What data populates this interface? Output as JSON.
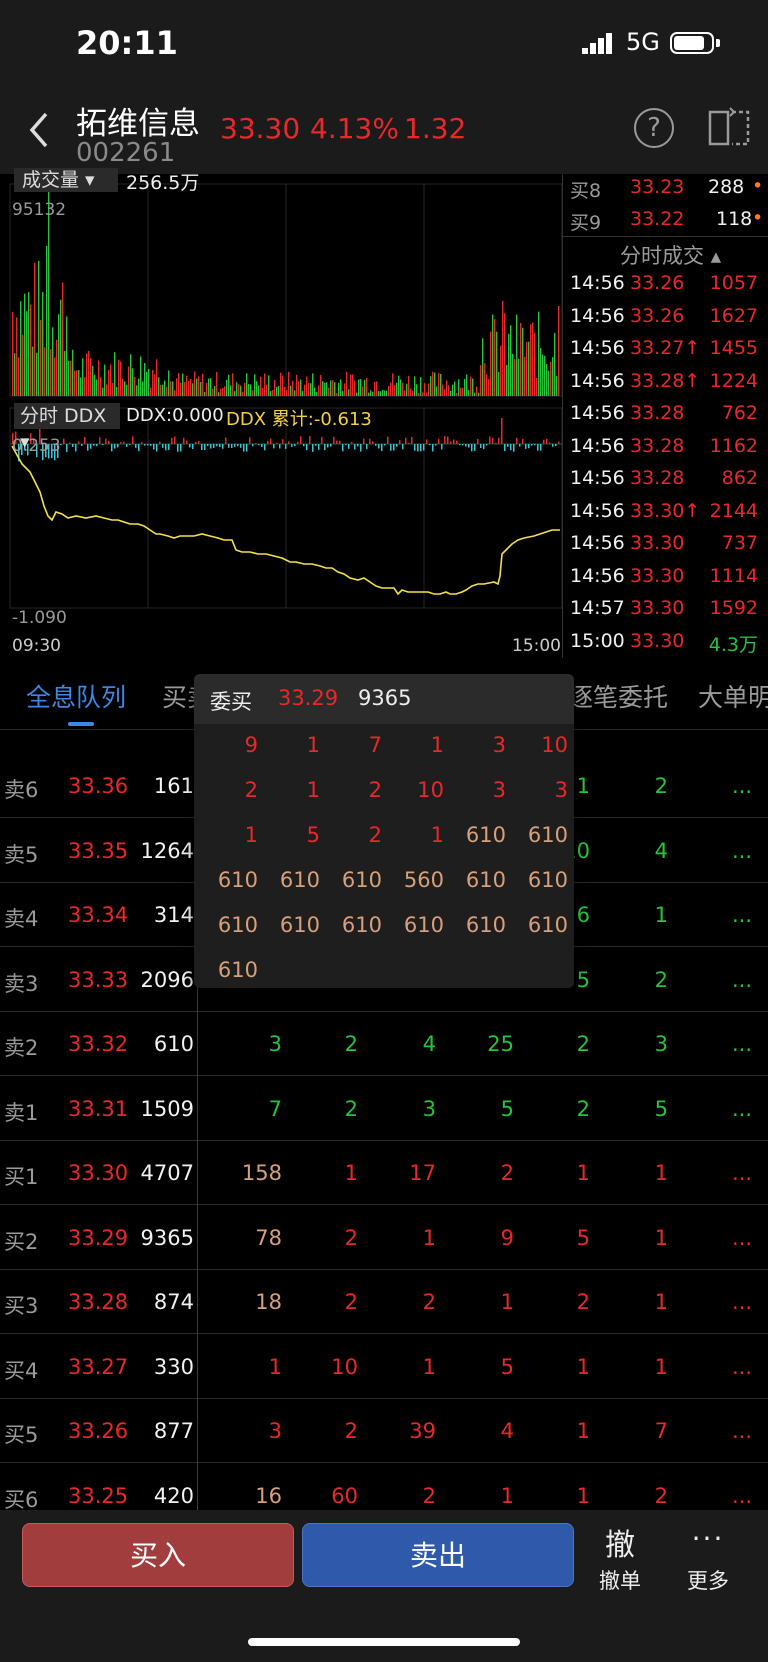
{
  "status": {
    "time": "20:11",
    "network": "5G"
  },
  "header": {
    "name": "拓维信息",
    "code": "002261",
    "price": "33.30",
    "pct": "4.13%",
    "change": "1.32",
    "help": "?"
  },
  "chart": {
    "vol_label": "成交量 ▾",
    "vol_value": "256.5万",
    "vol_max": "95132",
    "ddx_label": "分时 DDX ▾",
    "ddx_value": "DDX:0.000",
    "ddx_cum": "DDX 累计:-0.613",
    "ddx_max": "0.253",
    "ddx_min": "-1.090",
    "time_start": "09:30",
    "time_end": "15:00"
  },
  "right_panel": {
    "bids": [
      {
        "label": "买8",
        "price": "33.23",
        "vol": "288"
      },
      {
        "label": "买9",
        "price": "33.22",
        "vol": "118"
      }
    ],
    "ticks_title": "分时成交 ▴",
    "ticks": [
      {
        "t": "14:56",
        "p": "33.26",
        "v": "1057"
      },
      {
        "t": "14:56",
        "p": "33.26",
        "v": "1627"
      },
      {
        "t": "14:56",
        "p": "33.27↑",
        "v": "1455"
      },
      {
        "t": "14:56",
        "p": "33.28↑",
        "v": "1224"
      },
      {
        "t": "14:56",
        "p": "33.28",
        "v": "762"
      },
      {
        "t": "14:56",
        "p": "33.28",
        "v": "1162"
      },
      {
        "t": "14:56",
        "p": "33.28",
        "v": "862"
      },
      {
        "t": "14:56",
        "p": "33.30↑",
        "v": "2144"
      },
      {
        "t": "14:56",
        "p": "33.30",
        "v": "737"
      },
      {
        "t": "14:56",
        "p": "33.30",
        "v": "1114"
      },
      {
        "t": "14:57",
        "p": "33.30",
        "v": "1592"
      },
      {
        "t": "15:00",
        "p": "33.30",
        "v": "4.3万"
      }
    ]
  },
  "tabs": {
    "t1": "全息队列",
    "t2": "买卖",
    "t3": "逐笔委托",
    "t4": "大单明"
  },
  "queue": [
    {
      "label": "卖6",
      "price": "33.36",
      "vol": "161",
      "c": [
        "",
        "",
        "",
        "",
        "1",
        "2"
      ],
      "m": "..."
    },
    {
      "label": "卖5",
      "price": "33.35",
      "vol": "1264",
      "c": [
        "",
        "",
        "",
        "",
        "10",
        "4"
      ],
      "m": "..."
    },
    {
      "label": "卖4",
      "price": "33.34",
      "vol": "314",
      "c": [
        "",
        "",
        "",
        "",
        "6",
        "1"
      ],
      "m": "..."
    },
    {
      "label": "卖3",
      "price": "33.33",
      "vol": "2096",
      "c": [
        "",
        "",
        "",
        "",
        "5",
        "2"
      ],
      "m": "..."
    },
    {
      "label": "卖2",
      "price": "33.32",
      "vol": "610",
      "c": [
        "3",
        "2",
        "4",
        "25",
        "2",
        "3"
      ],
      "m": "..."
    },
    {
      "label": "卖1",
      "price": "33.31",
      "vol": "1509",
      "c": [
        "7",
        "2",
        "3",
        "5",
        "2",
        "5"
      ],
      "m": "..."
    },
    {
      "label": "买1",
      "price": "33.30",
      "vol": "4707",
      "c": [
        "158",
        "1",
        "17",
        "2",
        "1",
        "1"
      ],
      "m": "..."
    },
    {
      "label": "买2",
      "price": "33.29",
      "vol": "9365",
      "c": [
        "78",
        "2",
        "1",
        "9",
        "5",
        "1"
      ],
      "m": "..."
    },
    {
      "label": "买3",
      "price": "33.28",
      "vol": "874",
      "c": [
        "18",
        "2",
        "2",
        "1",
        "2",
        "1"
      ],
      "m": "..."
    },
    {
      "label": "买4",
      "price": "33.27",
      "vol": "330",
      "c": [
        "1",
        "10",
        "1",
        "5",
        "1",
        "1"
      ],
      "m": "..."
    },
    {
      "label": "买5",
      "price": "33.26",
      "vol": "877",
      "c": [
        "3",
        "2",
        "39",
        "4",
        "1",
        "7"
      ],
      "m": "..."
    },
    {
      "label": "买6",
      "price": "33.25",
      "vol": "420",
      "c": [
        "16",
        "60",
        "2",
        "1",
        "1",
        "2"
      ],
      "m": "..."
    }
  ],
  "popup": {
    "title": "委买",
    "price": "33.29",
    "vol": "9365",
    "rows": [
      [
        "9",
        "1",
        "7",
        "1",
        "3",
        "10"
      ],
      [
        "2",
        "1",
        "2",
        "10",
        "3",
        "3"
      ],
      [
        "1",
        "5",
        "2",
        "1",
        "610",
        "610"
      ],
      [
        "610",
        "610",
        "610",
        "560",
        "610",
        "610"
      ],
      [
        "610",
        "610",
        "610",
        "610",
        "610",
        "610"
      ],
      [
        "610"
      ]
    ]
  },
  "bottom": {
    "buy": "买入",
    "sell": "卖出",
    "cancel_icon": "撤",
    "cancel": "撤单",
    "more_icon": "···",
    "more": "更多"
  },
  "colors": {
    "up": "#e8282b",
    "down": "#25c43c",
    "large": "#d8a07a",
    "ddx_line": "#f4e04a",
    "ddx_neg": "#36c8d8"
  }
}
